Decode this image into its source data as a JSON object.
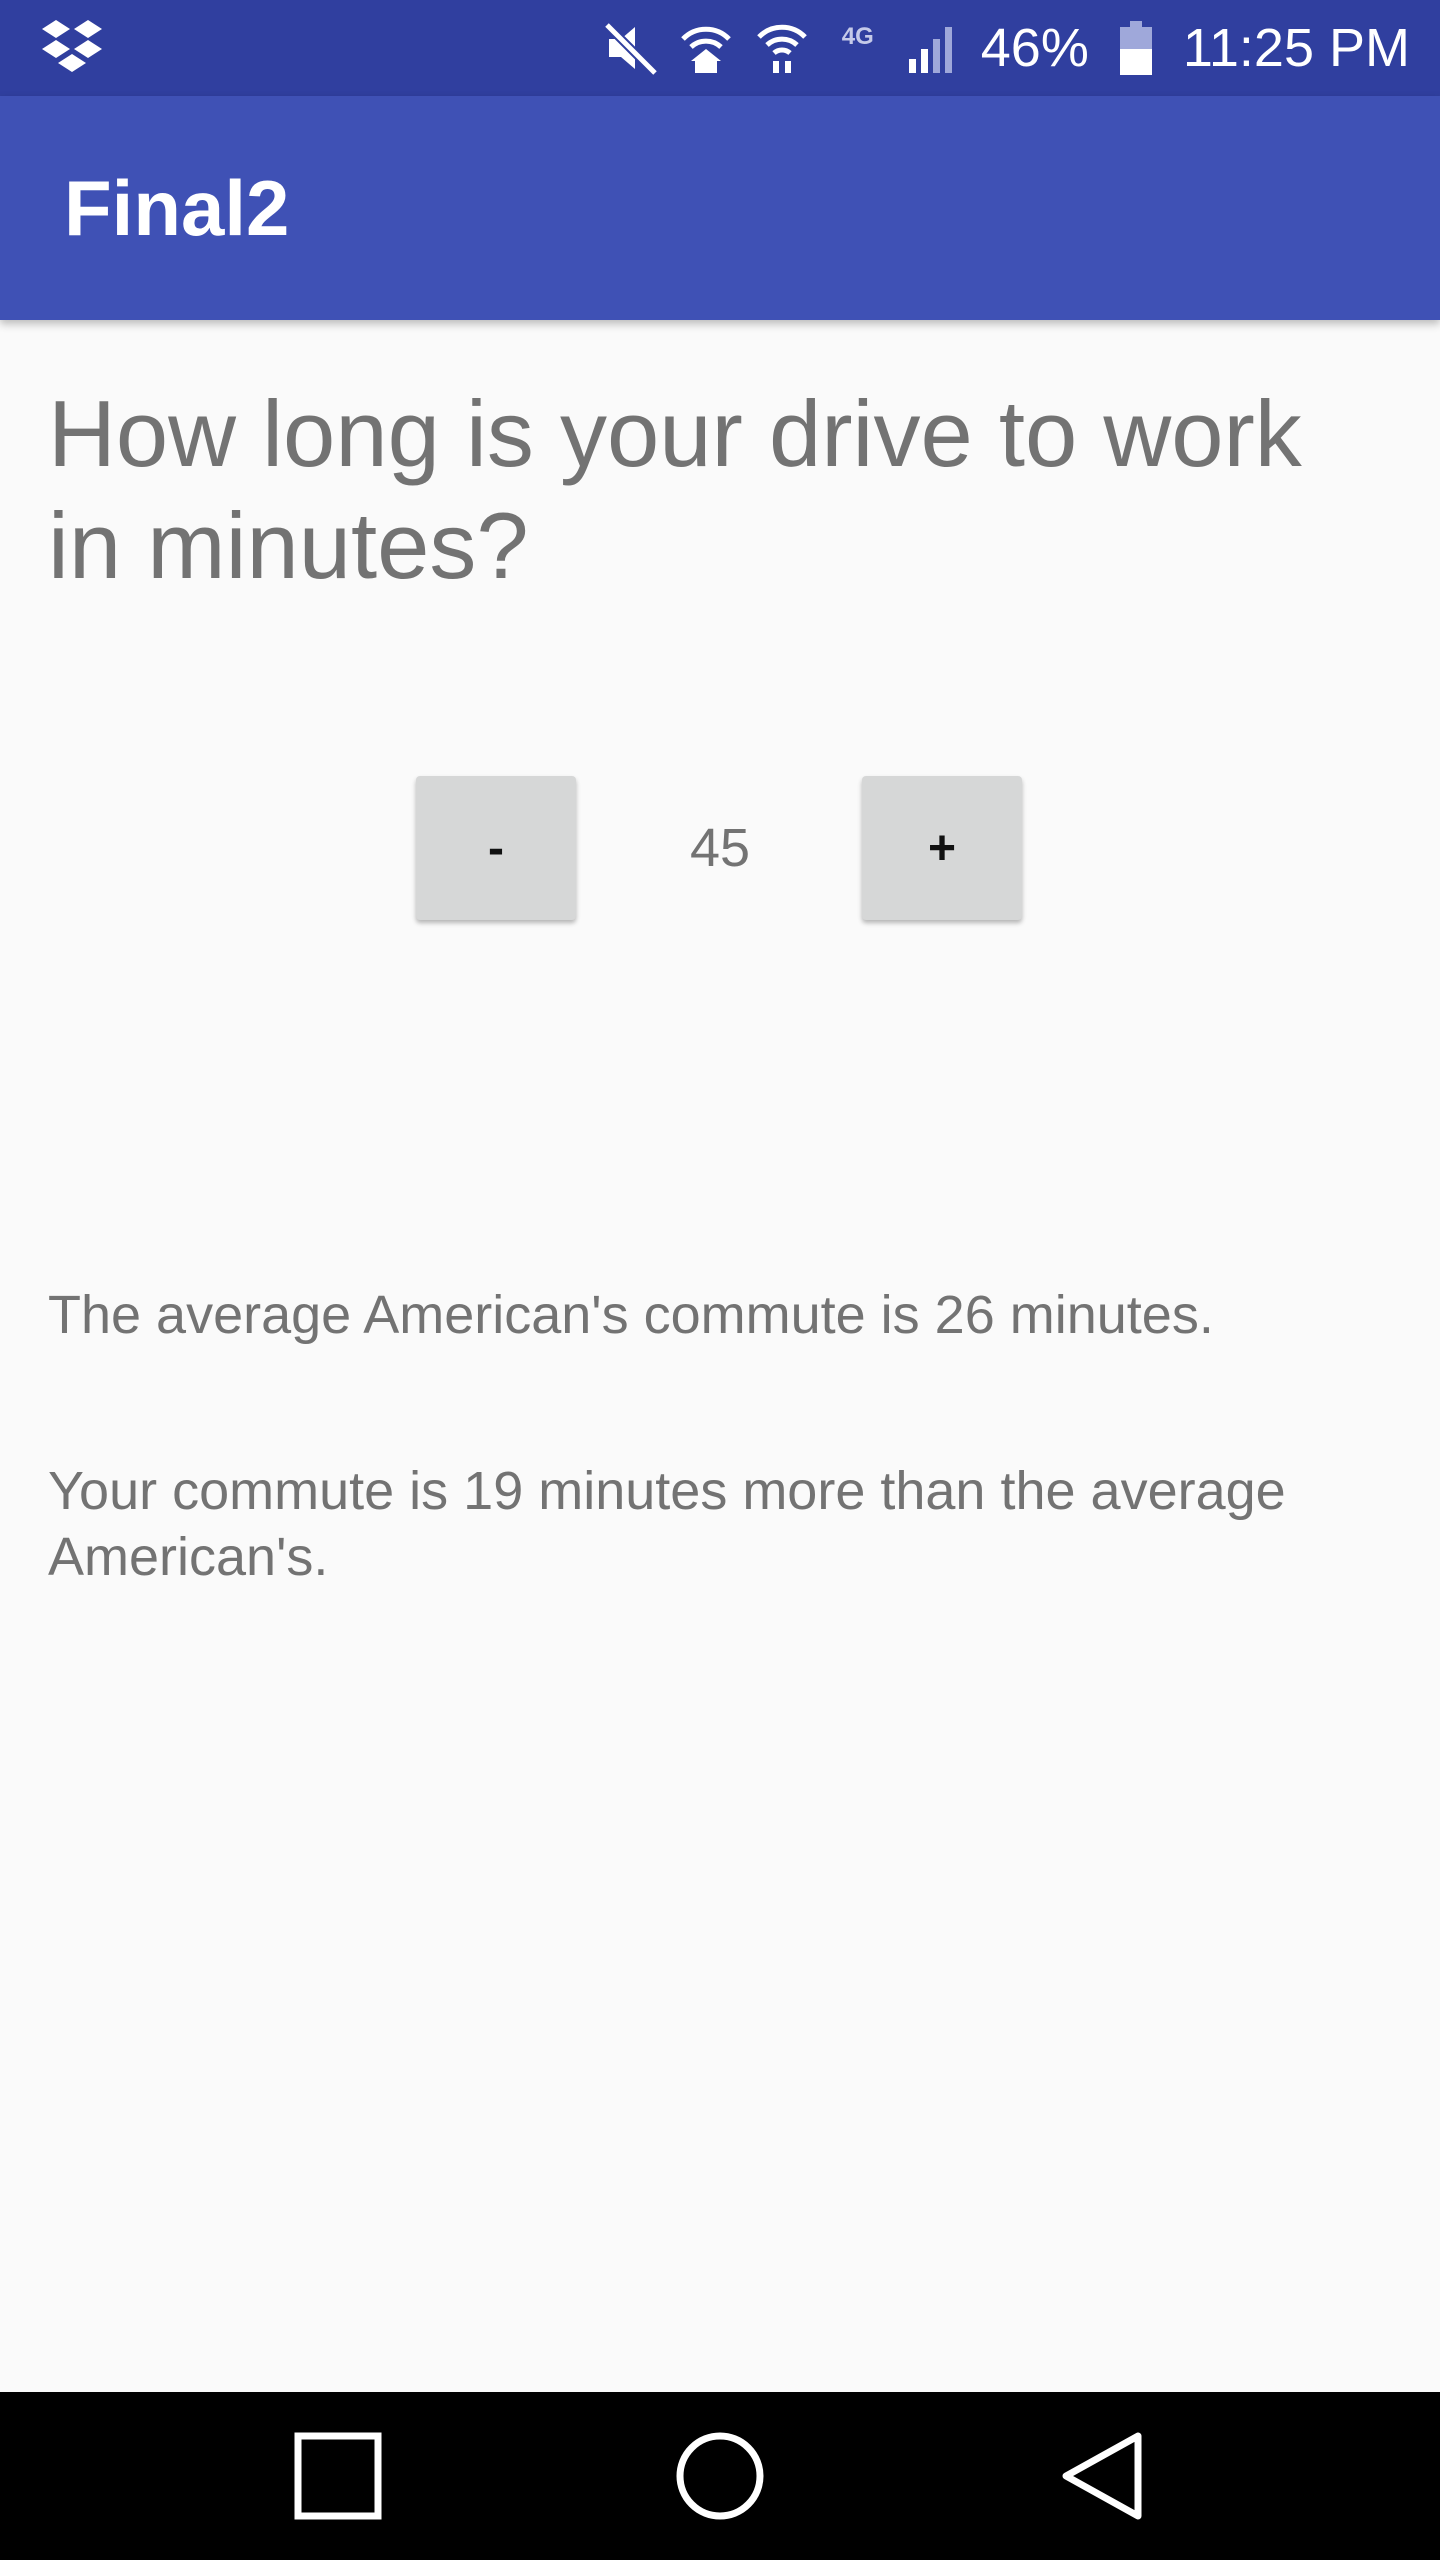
{
  "status_bar": {
    "battery": "46%",
    "time": "11:25 PM",
    "network": "4G",
    "icons": [
      "dropbox-icon",
      "mute-icon",
      "wifi-home-icon",
      "wifi-icon",
      "network-4g-icon",
      "signal-icon",
      "battery-icon"
    ]
  },
  "app_bar": {
    "title": "Final2"
  },
  "question": "How long is your drive to work in minutes?",
  "stepper": {
    "minus_label": "-",
    "value": "45",
    "plus_label": "+"
  },
  "average_text": "The average American's commute is 26 minutes.",
  "comparison_text": "Your commute is 19 minutes more than the average American's.",
  "nav_bar": {
    "icons": [
      "recents-icon",
      "home-icon",
      "back-icon"
    ]
  },
  "colors": {
    "status_bar": "#303f9f",
    "app_bar": "#3f51b5",
    "background": "#fafafa",
    "text": "#737373",
    "button": "#d6d7d7"
  }
}
